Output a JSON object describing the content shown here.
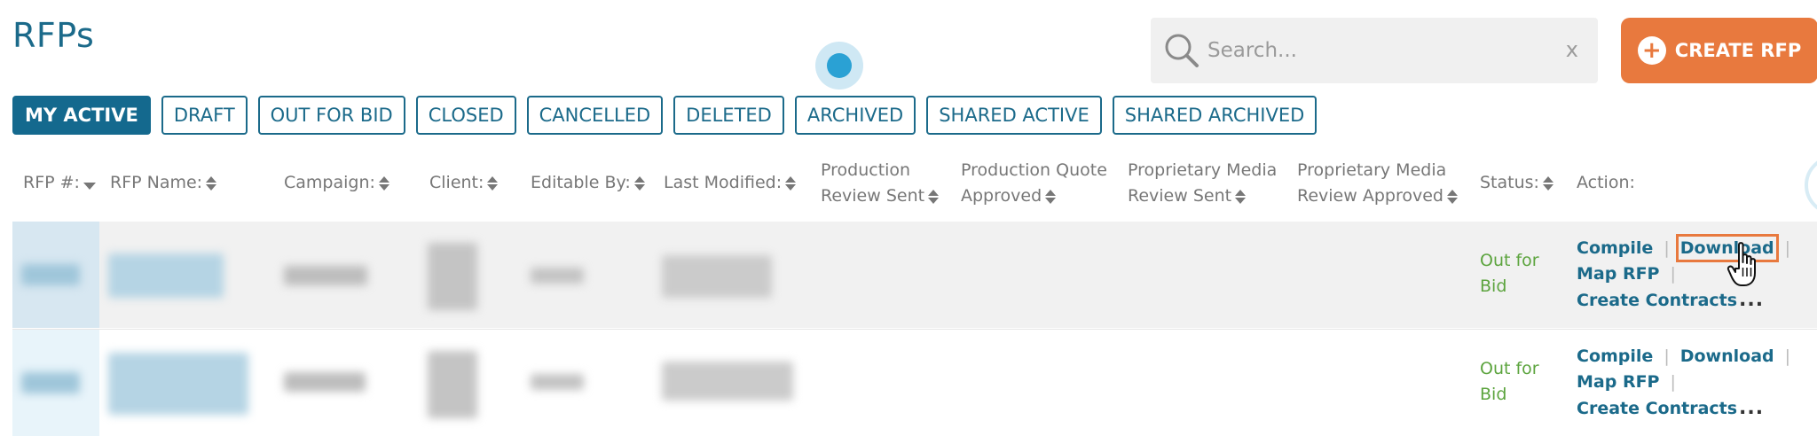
{
  "page": {
    "title": "RFPs"
  },
  "search": {
    "placeholder": "Search...",
    "clear_label": "x"
  },
  "create_button": {
    "label": "CREATE RFP"
  },
  "tabs": [
    {
      "label": "MY ACTIVE",
      "active": true
    },
    {
      "label": "DRAFT"
    },
    {
      "label": "OUT FOR BID"
    },
    {
      "label": "CLOSED"
    },
    {
      "label": "CANCELLED"
    },
    {
      "label": "DELETED"
    },
    {
      "label": "ARCHIVED"
    },
    {
      "label": "SHARED ACTIVE"
    },
    {
      "label": "SHARED ARCHIVED"
    }
  ],
  "columns": {
    "rfp_num": "RFP #:",
    "rfp_name": "RFP Name:",
    "campaign": "Campaign:",
    "client": "Client:",
    "editable_by": "Editable By:",
    "last_modified": "Last Modified:",
    "production_review_sent": [
      "Production",
      "Review Sent"
    ],
    "production_quote_approved": [
      "Production Quote",
      "Approved"
    ],
    "proprietary_media_review_sent": [
      "Proprietary Media",
      "Review Sent"
    ],
    "proprietary_media_review_approved": [
      "Proprietary Media",
      "Review Approved"
    ],
    "status": "Status:",
    "action": "Action:"
  },
  "rows": [
    {
      "status": [
        "Out for",
        "Bid"
      ],
      "actions": {
        "compile": "Compile",
        "download": "Download",
        "map_rfp": "Map RFP",
        "create_contracts": "Create Contracts",
        "more": "..."
      }
    },
    {
      "status": [
        "Out for",
        "Bid"
      ],
      "actions": {
        "compile": "Compile",
        "download": "Download",
        "map_rfp": "Map RFP",
        "create_contracts": "Create Contracts",
        "more": "..."
      }
    }
  ],
  "colors": {
    "primary": "#1b6a8a",
    "active_tab_bg": "#14698e",
    "create_button_bg": "#e8793e",
    "status_green": "#5ca43e",
    "highlight_outline": "#e8793e"
  }
}
